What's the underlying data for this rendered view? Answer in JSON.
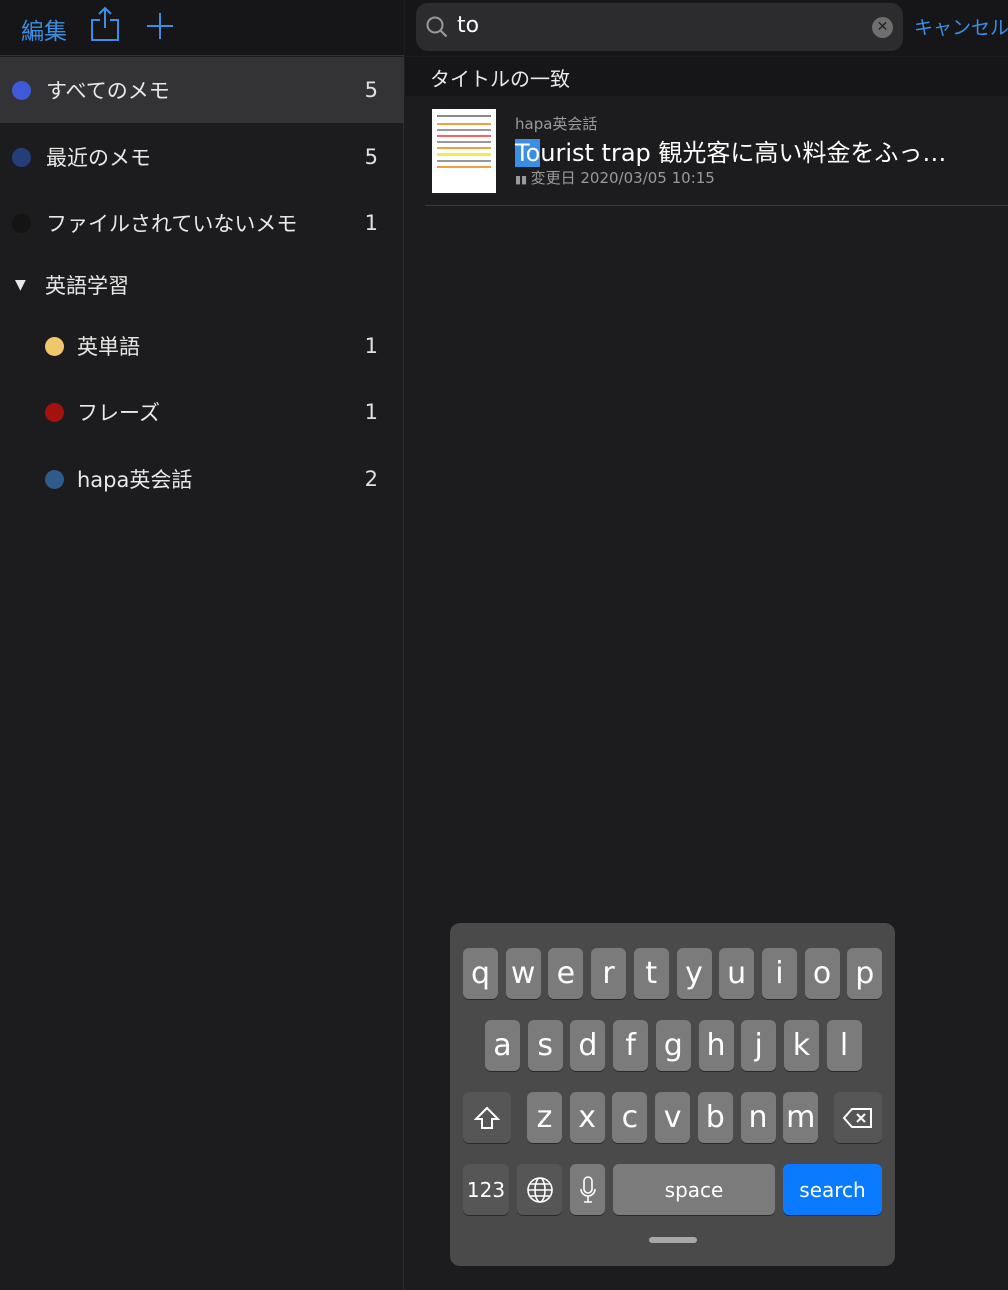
{
  "toolbar": {
    "edit_label": "編集",
    "share_icon": "share-icon",
    "add_icon": "plus-icon"
  },
  "sidebar": {
    "items": [
      {
        "label": "すべてのメモ",
        "count": "5",
        "color": "#3d5bd9"
      },
      {
        "label": "最近のメモ",
        "count": "5",
        "color": "#233f7a"
      },
      {
        "label": "ファイルされていないメモ",
        "count": "1",
        "color": "#141414"
      }
    ],
    "folder": {
      "label": "英語学習",
      "subitems": [
        {
          "label": "英単語",
          "count": "1",
          "color": "#f0c76a"
        },
        {
          "label": "フレーズ",
          "count": "1",
          "color": "#a4120f"
        },
        {
          "label": "hapa英会話",
          "count": "2",
          "color": "#2e5b8b"
        }
      ]
    }
  },
  "search": {
    "value": "to",
    "cancel_label": "キャンセル"
  },
  "results": {
    "section_title": "タイトルの一致",
    "items": [
      {
        "notebook": "hapa英会話",
        "title_match": "To",
        "title_rest": "urist trap  観光客に高い料金をふっ…",
        "modified": "変更日 2020/03/05 10:15"
      }
    ]
  },
  "keyboard": {
    "rows": [
      [
        "q",
        "w",
        "e",
        "r",
        "t",
        "y",
        "u",
        "i",
        "o",
        "p"
      ],
      [
        "a",
        "s",
        "d",
        "f",
        "g",
        "h",
        "j",
        "k",
        "l"
      ],
      [
        "z",
        "x",
        "c",
        "v",
        "b",
        "n",
        "m"
      ]
    ],
    "numbers_label": "123",
    "space_label": "space",
    "search_label": "search",
    "accent": "#0a7aff"
  }
}
